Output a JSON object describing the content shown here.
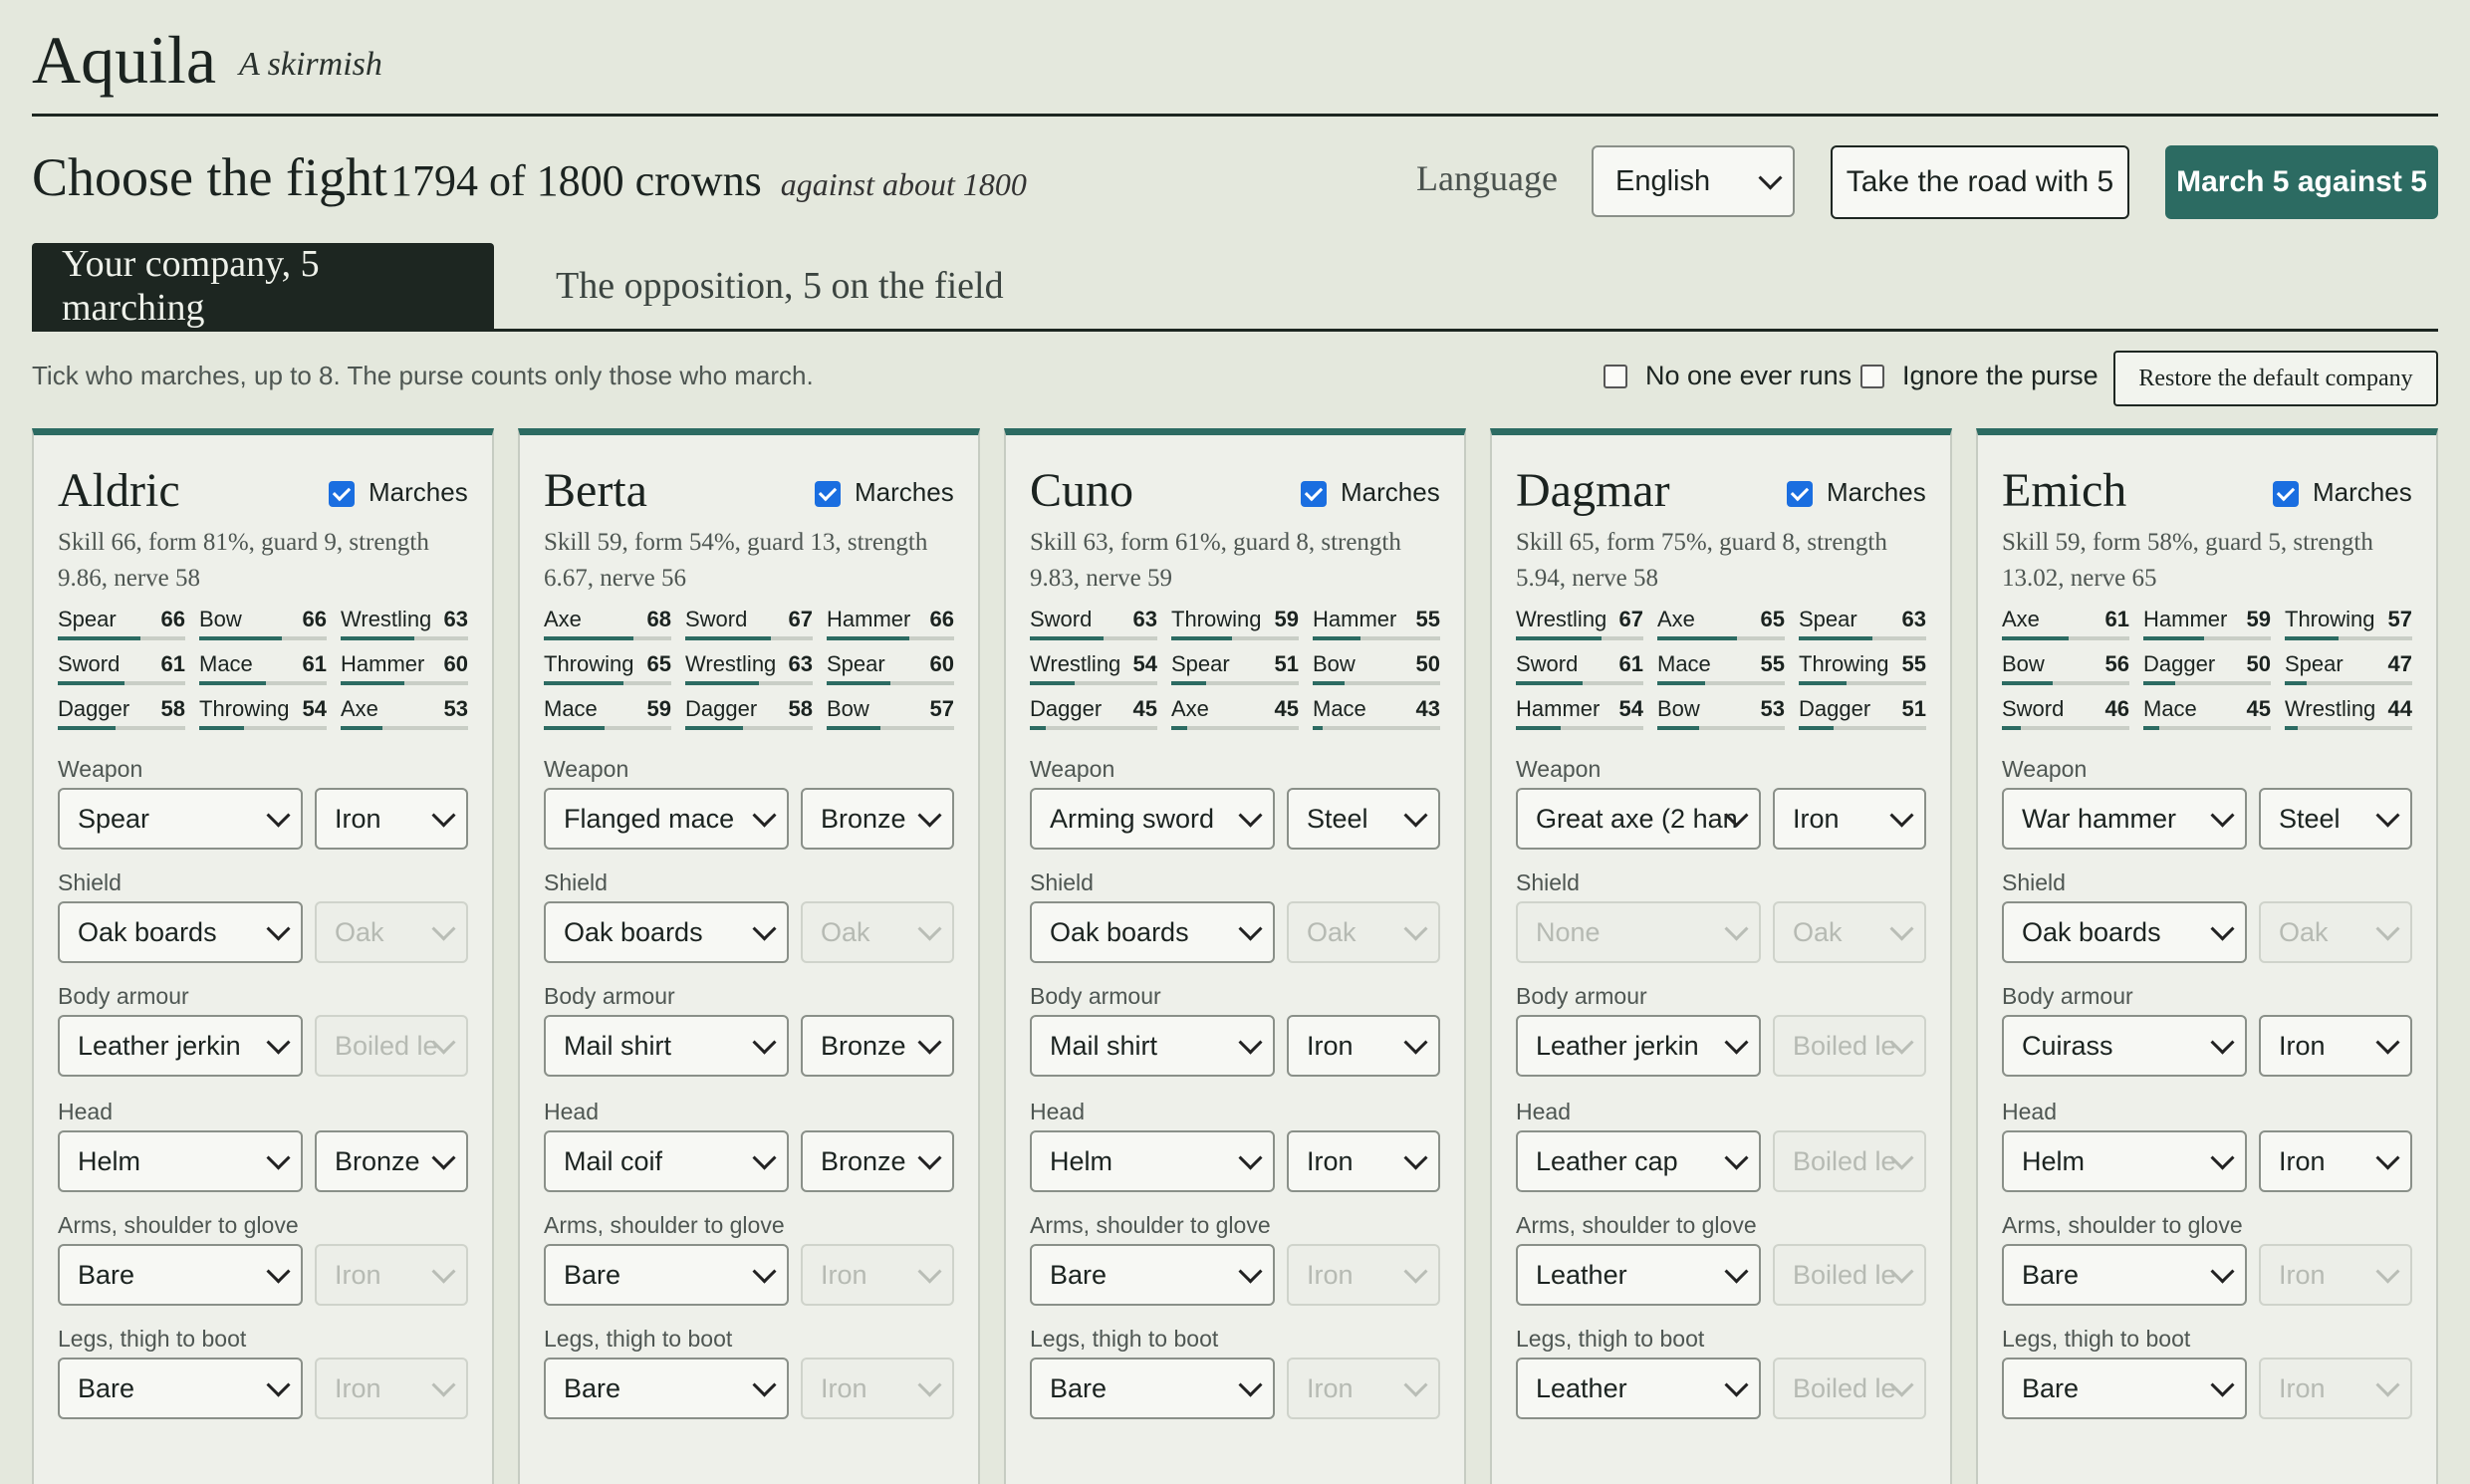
{
  "app": {
    "title": "Aquila",
    "subtitle": "A skirmish"
  },
  "header": {
    "choose": "Choose the fight",
    "crowns": "1794 of 1800 crowns",
    "against": "against about 1800",
    "language_label": "Language",
    "language_value": "English",
    "road_button": "Take the road with 5",
    "march_button": "March 5 against 5"
  },
  "tabs": [
    {
      "label": "Your company, 5 marching",
      "active": true
    },
    {
      "label": "The opposition, 5 on the field",
      "active": false
    }
  ],
  "toolbar": {
    "hint": "Tick who marches, up to 8. The purse counts only those who march.",
    "no_one_runs": "No one ever runs",
    "no_one_runs_checked": false,
    "ignore_purse": "Ignore the purse",
    "ignore_purse_checked": false,
    "restore": "Restore the default company"
  },
  "labels": {
    "marches": "Marches",
    "weapon": "Weapon",
    "shield": "Shield",
    "body": "Body armour",
    "head": "Head",
    "arms": "Arms, shoulder to glove",
    "legs": "Legs, thigh to boot"
  },
  "colors": {
    "accent": "#2c6b62",
    "ink": "#1d2621",
    "background": "#e4e8dd",
    "checkbox": "#1a6ee0"
  },
  "fighters": [
    {
      "name": "Aldric",
      "marches": true,
      "stats": "Skill 66, form 81%, guard 9, strength 9.86, nerve 58",
      "skills": [
        {
          "name": "Spear",
          "value": "66"
        },
        {
          "name": "Bow",
          "value": "66"
        },
        {
          "name": "Wrestling",
          "value": "63"
        },
        {
          "name": "Sword",
          "value": "61"
        },
        {
          "name": "Mace",
          "value": "61"
        },
        {
          "name": "Hammer",
          "value": "60"
        },
        {
          "name": "Dagger",
          "value": "58"
        },
        {
          "name": "Throwing",
          "value": "54"
        },
        {
          "name": "Axe",
          "value": "53"
        }
      ],
      "weapon": "Spear",
      "weapon_mat": "Iron",
      "shield": "Oak boards",
      "shield_mat": "Oak",
      "shield_mat_disabled": true,
      "body": "Leather jerkin",
      "body_mat": "Boiled le",
      "body_mat_disabled": true,
      "head": "Helm",
      "head_mat": "Bronze",
      "head_mat_disabled": false,
      "arms": "Bare",
      "arms_mat": "Iron",
      "arms_mat_disabled": true,
      "legs": "Bare",
      "legs_mat": "Iron",
      "legs_mat_disabled": true
    },
    {
      "name": "Berta",
      "marches": true,
      "stats": "Skill 59, form 54%, guard 13, strength 6.67, nerve 56",
      "skills": [
        {
          "name": "Axe",
          "value": "68"
        },
        {
          "name": "Sword",
          "value": "67"
        },
        {
          "name": "Hammer",
          "value": "66"
        },
        {
          "name": "Throwing",
          "value": "65"
        },
        {
          "name": "Wrestling",
          "value": "63"
        },
        {
          "name": "Spear",
          "value": "60"
        },
        {
          "name": "Mace",
          "value": "59"
        },
        {
          "name": "Dagger",
          "value": "58"
        },
        {
          "name": "Bow",
          "value": "57"
        }
      ],
      "weapon": "Flanged mace",
      "weapon_mat": "Bronze",
      "shield": "Oak boards",
      "shield_mat": "Oak",
      "shield_mat_disabled": true,
      "body": "Mail shirt",
      "body_mat": "Bronze",
      "body_mat_disabled": false,
      "head": "Mail coif",
      "head_mat": "Bronze",
      "head_mat_disabled": false,
      "arms": "Bare",
      "arms_mat": "Iron",
      "arms_mat_disabled": true,
      "legs": "Bare",
      "legs_mat": "Iron",
      "legs_mat_disabled": true
    },
    {
      "name": "Cuno",
      "marches": true,
      "stats": "Skill 63, form 61%, guard 8, strength 9.83, nerve 59",
      "skills": [
        {
          "name": "Sword",
          "value": "63"
        },
        {
          "name": "Throwing",
          "value": "59"
        },
        {
          "name": "Hammer",
          "value": "55"
        },
        {
          "name": "Wrestling",
          "value": "54"
        },
        {
          "name": "Spear",
          "value": "51"
        },
        {
          "name": "Bow",
          "value": "50"
        },
        {
          "name": "Dagger",
          "value": "45"
        },
        {
          "name": "Axe",
          "value": "45"
        },
        {
          "name": "Mace",
          "value": "43"
        }
      ],
      "weapon": "Arming sword",
      "weapon_mat": "Steel",
      "shield": "Oak boards",
      "shield_mat": "Oak",
      "shield_mat_disabled": true,
      "body": "Mail shirt",
      "body_mat": "Iron",
      "body_mat_disabled": false,
      "head": "Helm",
      "head_mat": "Iron",
      "head_mat_disabled": false,
      "arms": "Bare",
      "arms_mat": "Iron",
      "arms_mat_disabled": true,
      "legs": "Bare",
      "legs_mat": "Iron",
      "legs_mat_disabled": true
    },
    {
      "name": "Dagmar",
      "marches": true,
      "stats": "Skill 65, form 75%, guard 8, strength 5.94, nerve 58",
      "skills": [
        {
          "name": "Wrestling",
          "value": "67"
        },
        {
          "name": "Axe",
          "value": "65"
        },
        {
          "name": "Spear",
          "value": "63"
        },
        {
          "name": "Sword",
          "value": "61"
        },
        {
          "name": "Mace",
          "value": "55"
        },
        {
          "name": "Throwing",
          "value": "55"
        },
        {
          "name": "Hammer",
          "value": "54"
        },
        {
          "name": "Bow",
          "value": "53"
        },
        {
          "name": "Dagger",
          "value": "51"
        }
      ],
      "weapon": "Great axe (2 han",
      "weapon_mat": "Iron",
      "shield": "None",
      "shield_disabled": true,
      "shield_mat": "Oak",
      "shield_mat_disabled": true,
      "body": "Leather jerkin",
      "body_mat": "Boiled le",
      "body_mat_disabled": true,
      "head": "Leather cap",
      "head_mat": "Boiled le",
      "head_mat_disabled": true,
      "arms": "Leather",
      "arms_mat": "Boiled le",
      "arms_mat_disabled": true,
      "legs": "Leather",
      "legs_mat": "Boiled le",
      "legs_mat_disabled": true
    },
    {
      "name": "Emich",
      "marches": true,
      "stats": "Skill 59, form 58%, guard 5, strength 13.02, nerve 65",
      "skills": [
        {
          "name": "Axe",
          "value": "61"
        },
        {
          "name": "Hammer",
          "value": "59"
        },
        {
          "name": "Throwing",
          "value": "57"
        },
        {
          "name": "Bow",
          "value": "56"
        },
        {
          "name": "Dagger",
          "value": "50"
        },
        {
          "name": "Spear",
          "value": "47"
        },
        {
          "name": "Sword",
          "value": "46"
        },
        {
          "name": "Mace",
          "value": "45"
        },
        {
          "name": "Wrestling",
          "value": "44"
        }
      ],
      "weapon": "War hammer",
      "weapon_mat": "Steel",
      "shield": "Oak boards",
      "shield_mat": "Oak",
      "shield_mat_disabled": true,
      "body": "Cuirass",
      "body_mat": "Iron",
      "body_mat_disabled": false,
      "head": "Helm",
      "head_mat": "Iron",
      "head_mat_disabled": false,
      "arms": "Bare",
      "arms_mat": "Iron",
      "arms_mat_disabled": true,
      "legs": "Bare",
      "legs_mat": "Iron",
      "legs_mat_disabled": true
    }
  ]
}
